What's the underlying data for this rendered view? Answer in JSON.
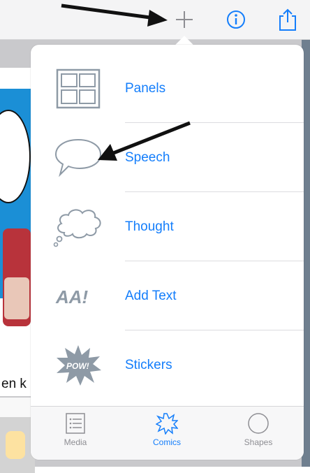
{
  "toolbar": {
    "add_icon": "plus-icon",
    "info_icon": "info-icon",
    "share_icon": "share-icon"
  },
  "background": {
    "partial_text": "en k"
  },
  "menu": {
    "items": [
      {
        "label": "Panels",
        "icon": "panels-grid-icon"
      },
      {
        "label": "Speech",
        "icon": "speech-bubble-icon"
      },
      {
        "label": "Thought",
        "icon": "thought-bubble-icon"
      },
      {
        "label": "Add Text",
        "icon": "add-text-icon",
        "icon_text": "AA!"
      },
      {
        "label": "Stickers",
        "icon": "pow-sticker-icon",
        "icon_text": "POW!"
      }
    ]
  },
  "tabs": [
    {
      "label": "Media",
      "icon": "media-list-icon",
      "selected": false
    },
    {
      "label": "Comics",
      "icon": "comics-burst-icon",
      "selected": true
    },
    {
      "label": "Shapes",
      "icon": "circle-shape-icon",
      "selected": false
    }
  ],
  "colors": {
    "accent": "#147efb",
    "icon_gray": "#8e9aa6",
    "tab_inactive": "#8e8e93",
    "annotation_arrow": "#111111"
  }
}
